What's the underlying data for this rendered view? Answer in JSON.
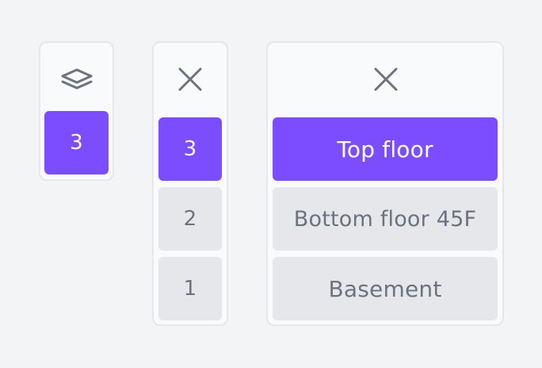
{
  "colors": {
    "page_background": "#f3f4f6",
    "panel_background": "#f9fafb",
    "panel_border": "#e5e7eb",
    "active": "#7c4dff",
    "active_text": "#ffffff",
    "inactive": "#e5e7eb",
    "inactive_text": "#6b7280",
    "icon": "#6b7280"
  },
  "collapsed_control": {
    "icon": "layers-icon",
    "selected_floor": "3"
  },
  "numeric_control": {
    "icon": "close-icon",
    "floors": [
      {
        "label": "3",
        "active": true
      },
      {
        "label": "2",
        "active": false
      },
      {
        "label": "1",
        "active": false
      }
    ]
  },
  "named_control": {
    "icon": "close-icon",
    "floors": [
      {
        "label": "Top floor",
        "active": true
      },
      {
        "label": "Bottom floor 45F",
        "active": false
      },
      {
        "label": "Basement",
        "active": false
      }
    ]
  }
}
